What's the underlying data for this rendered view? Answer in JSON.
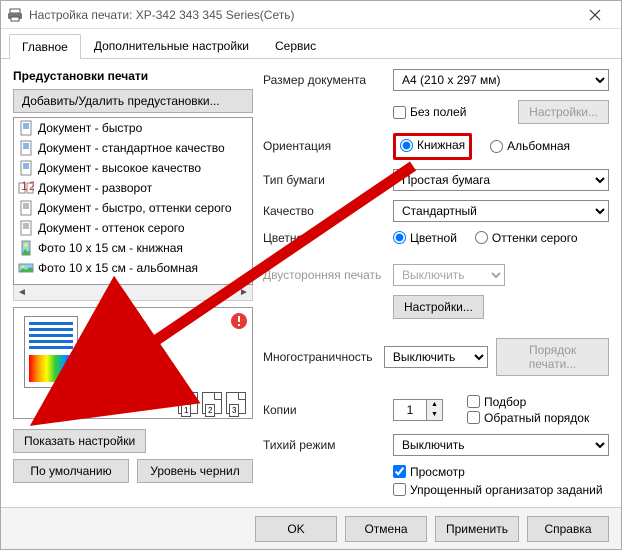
{
  "window": {
    "title": "Настройка печати: XP-342 343 345 Series(Сеть)"
  },
  "tabs": [
    "Главное",
    "Дополнительные настройки",
    "Сервис"
  ],
  "presets": {
    "title": "Предустановки печати",
    "add_remove": "Добавить/Удалить предустановки...",
    "items": [
      "Документ - быстро",
      "Документ - стандартное качество",
      "Документ - высокое качество",
      "Документ - разворот",
      "Документ - быстро, оттенки серого",
      "Документ - оттенок серого",
      "Фото 10 x 15 см - книжная",
      "Фото 10 x 15 см - альбомная"
    ]
  },
  "left_buttons": {
    "show_settings": "Показать настройки",
    "default": "По умолчанию",
    "ink": "Уровень чернил"
  },
  "settings": {
    "doc_size_label": "Размер документа",
    "doc_size_value": "A4 (210 x 297 мм)",
    "borderless": "Без полей",
    "borderless_settings": "Настройки...",
    "orientation_label": "Ориентация",
    "orientation_portrait": "Книжная",
    "orientation_landscape": "Альбомная",
    "paper_type_label": "Тип бумаги",
    "paper_type_value": "Простая бумага",
    "quality_label": "Качество",
    "quality_value": "Стандартный",
    "color_label": "Цветной",
    "color_color": "Цветной",
    "color_gray": "Оттенки серого",
    "duplex_label": "Двусторонняя печать",
    "duplex_value": "Выключить",
    "duplex_settings": "Настройки...",
    "multi_label": "Многостраничность",
    "multi_value": "Выключить",
    "multi_order": "Порядок печати...",
    "copies_label": "Копии",
    "copies_value": "1",
    "collate": "Подбор",
    "reverse": "Обратный порядок",
    "quiet_label": "Тихий режим",
    "quiet_value": "Выключить",
    "preview": "Просмотр",
    "simple": "Упрощенный организатор заданий"
  },
  "bottom": {
    "ok": "OK",
    "cancel": "Отмена",
    "apply": "Применить",
    "help": "Справка"
  },
  "mini_pages": [
    "1",
    "2",
    "3"
  ]
}
